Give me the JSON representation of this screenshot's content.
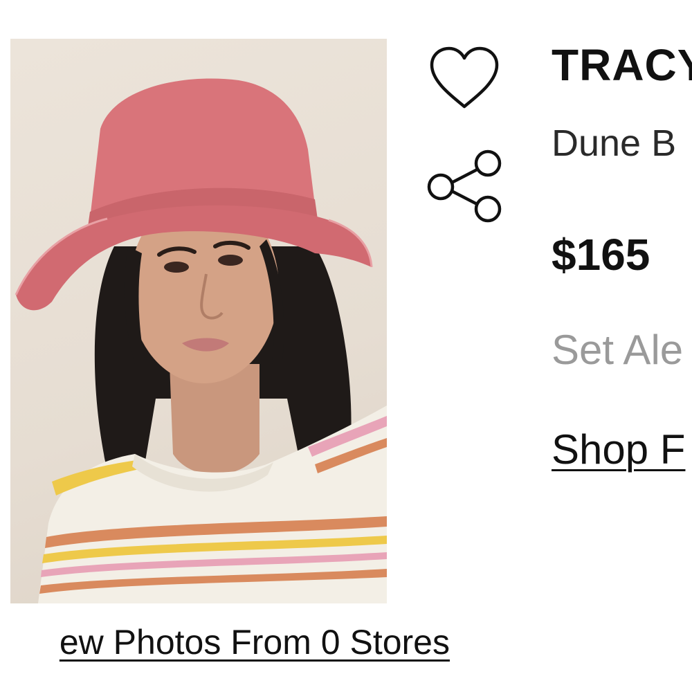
{
  "product": {
    "brand": "TRACY",
    "name": "Dune B",
    "price": "$165",
    "set_alert_label": "Set Ale",
    "shop_link_label": "Shop F",
    "view_photos_label": "ew Photos From 0 Stores"
  },
  "actions": {
    "favorite_icon": "heart-icon",
    "share_icon": "share-icon"
  },
  "colors": {
    "text": "#111111",
    "muted": "#9a9a9a",
    "hat": "#d9747a"
  }
}
